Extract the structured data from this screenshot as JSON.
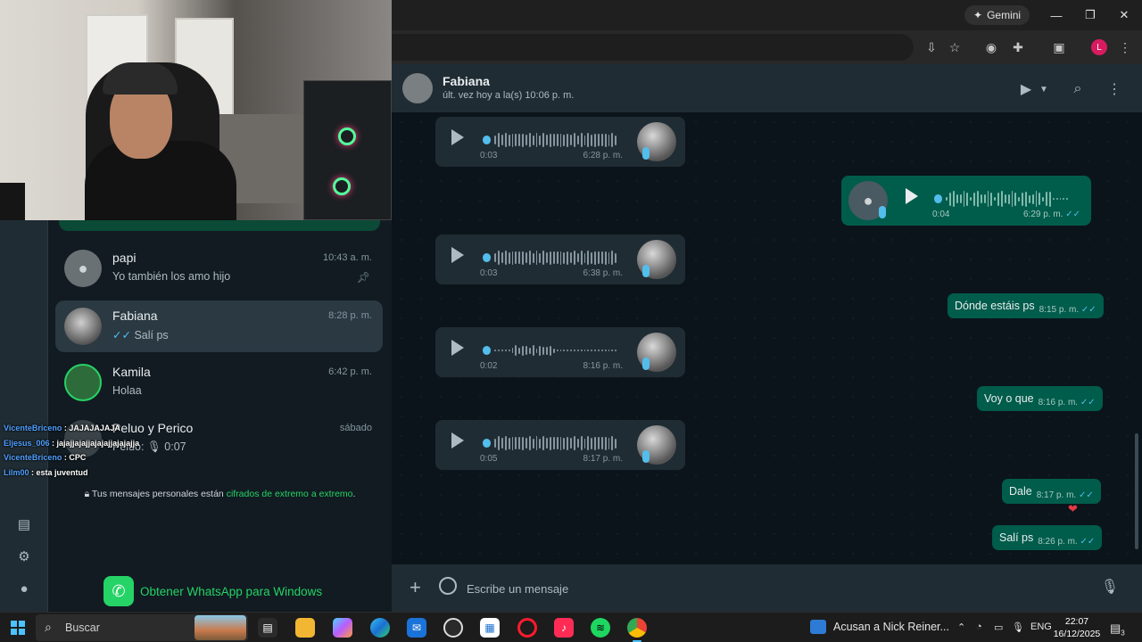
{
  "browser": {
    "gemini_label": "Gemini",
    "profile_initial": "L"
  },
  "stream_chat": [
    {
      "user": "VicenteBriceno",
      "text": "JAJAJAJAJA"
    },
    {
      "user": "Eljesus_006",
      "text": "jajajjajajjajajajjajajajja"
    },
    {
      "user": "VicenteBriceno",
      "text": "CPC"
    },
    {
      "user": "Lilm00",
      "text": "esta juventud"
    }
  ],
  "chat_list": [
    {
      "name": "papi",
      "time": "10:43 a. m.",
      "preview": "Yo también los amo hijo",
      "pinned": true
    },
    {
      "name": "Fabiana",
      "time": "8:28 p. m.",
      "preview": "Salí ps",
      "active": true
    },
    {
      "name": "Kamila",
      "time": "6:42 p. m.",
      "preview": "Holaa"
    },
    {
      "name": "Peluo y Perico",
      "time": "sábado",
      "preview_sender": "Peluo:",
      "preview": "0:07"
    }
  ],
  "encryption": {
    "text": "Tus mensajes personales están ",
    "link": "cifrados de extremo a extremo",
    "end": "."
  },
  "get_whatsapp": "Obtener WhatsApp para Windows",
  "conversation": {
    "name": "Fabiana",
    "status": "últ. vez hoy a la(s) 10:06 p. m."
  },
  "messages": {
    "v1": {
      "duration": "0:03",
      "time": "6:28 p. m."
    },
    "v2": {
      "duration": "0:04",
      "time": "6:29 p. m."
    },
    "v3": {
      "duration": "0:03",
      "time": "6:38 p. m."
    },
    "t1": {
      "text": "Dónde estáis ps",
      "time": "8:15 p. m."
    },
    "v4": {
      "duration": "0:02",
      "time": "8:16 p. m."
    },
    "t2": {
      "text": "Voy o que",
      "time": "8:16 p. m."
    },
    "v5": {
      "duration": "0:05",
      "time": "8:17 p. m."
    },
    "t3": {
      "text": "Dale",
      "time": "8:17 p. m."
    },
    "t4": {
      "text": "Salí ps",
      "time": "8:26 p. m."
    }
  },
  "composer": {
    "placeholder": "Escribe un mensaje"
  },
  "taskbar": {
    "search_label": "Buscar",
    "news": "Acusan a Nick Reiner...",
    "language": "ENG",
    "time": "22:07",
    "date": "16/12/2025",
    "notif_count": "3"
  }
}
